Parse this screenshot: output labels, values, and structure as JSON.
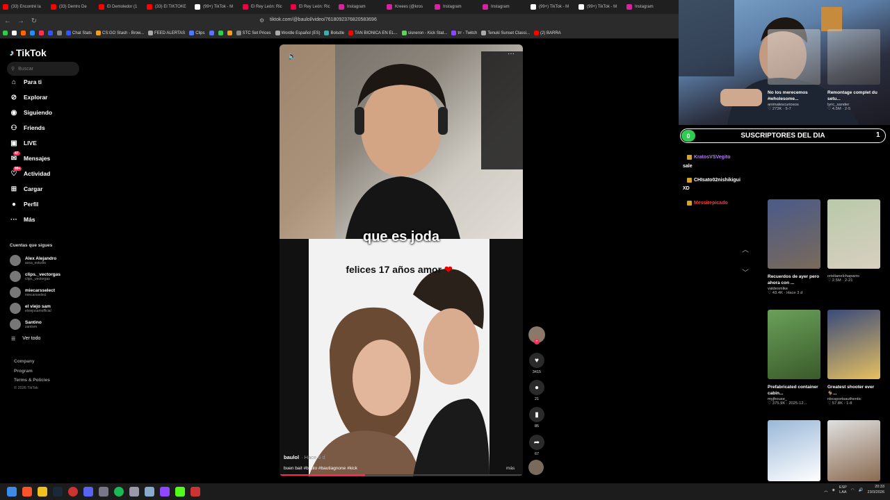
{
  "tabs": [
    {
      "label": "(33) Encontré la",
      "color": "#ff0000"
    },
    {
      "label": "(33) Dentro De",
      "color": "#ff0000"
    },
    {
      "label": "El Demoledor (1",
      "color": "#ff0000"
    },
    {
      "label": "(33) El TIKTOKE",
      "color": "#ff0000"
    },
    {
      "label": "(99+) TikTok - M",
      "color": "#ffffff"
    },
    {
      "label": "El Rey León: Ric",
      "color": "#e04"
    },
    {
      "label": "El Rey León: Ric",
      "color": "#e04"
    },
    {
      "label": "Instagram",
      "color": "#d6249f"
    },
    {
      "label": "Kreees (@kros",
      "color": "#d6249f"
    },
    {
      "label": "Instagram",
      "color": "#d6249f"
    },
    {
      "label": "Instagram",
      "color": "#d6249f"
    },
    {
      "label": "(99+) TikTok - M",
      "color": "#ffffff"
    },
    {
      "label": "(99+) TikTok - M",
      "color": "#ffffff"
    },
    {
      "label": "Instagram",
      "color": "#d6249f"
    }
  ],
  "address": {
    "url": "tiktok.com/@baulol/video/7618092376820583696"
  },
  "bookmarks": [
    {
      "label": "",
      "color": "#2ecc4f"
    },
    {
      "label": "",
      "color": "#fff"
    },
    {
      "label": "",
      "color": "#ff6600"
    },
    {
      "label": "",
      "color": "#1e90ff"
    },
    {
      "label": "",
      "color": "#ff3355"
    },
    {
      "label": "",
      "color": "#3355ff"
    },
    {
      "label": "",
      "color": "#888"
    },
    {
      "label": "Chat Stats",
      "color": "#3355ff"
    },
    {
      "label": "CS:GO Stash - Brow...",
      "color": "#f0a020"
    },
    {
      "label": "FEED ALERTAS",
      "color": "#aaa"
    },
    {
      "label": "Clips",
      "color": "#5577ff"
    },
    {
      "label": "",
      "color": "#5577ff"
    },
    {
      "label": "",
      "color": "#2ecc4f"
    },
    {
      "label": "",
      "color": "#f0a020"
    },
    {
      "label": "STC Set Prices",
      "color": "#888"
    },
    {
      "label": "Wordle Español (ES)",
      "color": "#aaa"
    },
    {
      "label": "Bolsdle",
      "color": "#4aa"
    },
    {
      "label": "TAN BIONICA EN EL...",
      "color": "#ff0000"
    },
    {
      "label": "sisneron - Kick Stat...",
      "color": "#6c6"
    },
    {
      "label": "trr - Twitch",
      "color": "#9146ff"
    },
    {
      "label": "Tenuki Sunset Classi...",
      "color": "#aaa"
    },
    {
      "label": "(2) BARRA",
      "color": "#ff0000"
    }
  ],
  "tiktok": {
    "logo": "TikTok",
    "search_placeholder": "Buscar",
    "nav": [
      {
        "label": "Para ti",
        "icon": "⌂",
        "name": "home-icon"
      },
      {
        "label": "Explorar",
        "icon": "⊘",
        "name": "compass-icon"
      },
      {
        "label": "Siguiendo",
        "icon": "◉",
        "name": "following-icon"
      },
      {
        "label": "Friends",
        "icon": "⚇",
        "name": "friends-icon"
      },
      {
        "label": "LIVE",
        "icon": "▣",
        "name": "live-icon"
      },
      {
        "label": "Mensajes",
        "icon": "✉",
        "name": "messages-icon",
        "badge": "47"
      },
      {
        "label": "Actividad",
        "icon": "♡",
        "name": "activity-icon",
        "badge": "99+"
      },
      {
        "label": "Cargar",
        "icon": "⊞",
        "name": "upload-icon"
      },
      {
        "label": "Perfil",
        "icon": "●",
        "name": "profile-icon"
      },
      {
        "label": "Más",
        "icon": "···",
        "name": "more-icon"
      }
    ],
    "following_title": "Cuentas que sigues",
    "accounts": [
      {
        "name": "Alex Alejandro",
        "handle": "aoca_estudio"
      },
      {
        "name": "clips._vectorgas",
        "handle": "clips._vectorgas"
      },
      {
        "name": "miecarsselect",
        "handle": "miecarsselect"
      },
      {
        "name": "el viejo sam",
        "handle": "elviejosamofficial"
      },
      {
        "name": "Santino",
        "handle": "zantivm"
      }
    ],
    "see_all": "Ver todo",
    "footer": [
      "Company",
      "Program",
      "Terms & Policies"
    ],
    "copyright": "© 2026 TikTok",
    "video": {
      "caption_big": "que es joda",
      "overlay_text": "felices 17 años amor",
      "overlay_emoji": "❤",
      "author": "baulol",
      "ago": "· Hace 6 d",
      "description": "buen bait #baulo #bautiagnone #kick",
      "more": "más",
      "progress": 0.35
    },
    "actions": [
      {
        "icon": "♥",
        "count": "3415",
        "name": "like"
      },
      {
        "icon": "●",
        "count": "21",
        "name": "comment"
      },
      {
        "icon": "▮",
        "count": "85",
        "name": "bookmark"
      },
      {
        "icon": "➦",
        "count": "67",
        "name": "share"
      }
    ]
  },
  "stream": {
    "sub_label": "SUSCRIPTORES DEL DIA",
    "sub_count": "0",
    "sub_right": "1",
    "chat": [
      {
        "user": "KratosVSVegito",
        "color": "#b57bff",
        "msg": "sale"
      },
      {
        "user": "CHIsato02nishikigui",
        "color": "#ffffff",
        "msg": "XD"
      },
      {
        "user": "Messirepicado",
        "color": "#ff3b3b",
        "msg": ""
      }
    ]
  },
  "recommended": [
    {
      "caption": "No los merecemos #wholesome...",
      "author": "animalescuriosos",
      "stats": "♡ 273K · 5-7"
    },
    {
      "caption": "Remontage complet du setu...",
      "author": "lyric_sander",
      "stats": "♡ 4.5M · 2-5"
    },
    {
      "caption": "Recuerdos de ayer pero ahora con ...",
      "author": "valdesmike",
      "stats": "♡ 43.4K · Hace 3 d"
    },
    {
      "caption": "",
      "author": "cristianelchaparro",
      "stats": "♡ 2.5M · 2-21"
    },
    {
      "caption": "Prefabricated container cabin...",
      "author": "myjhouse_",
      "stats": "♡ 375.9K · 2025-12..."
    },
    {
      "caption": "Greatest shooter ever 🐐...",
      "author": "nbcsportsauthentic",
      "stats": "♡ 57.8K · 1-8"
    }
  ],
  "taskbar": {
    "lang": "ESP\nLAA",
    "time": "20:33",
    "date": "23/3/2026"
  }
}
